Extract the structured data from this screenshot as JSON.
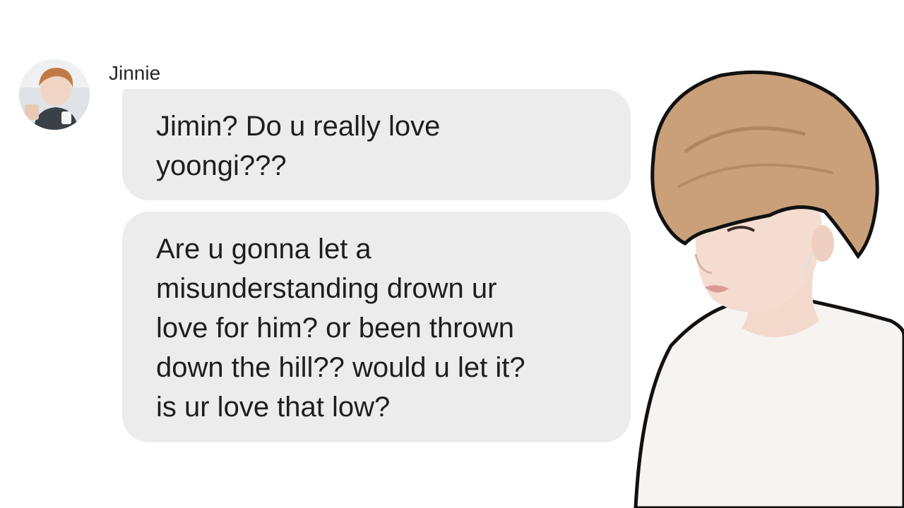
{
  "chat": {
    "sender_name": "Jinnie",
    "messages": [
      {
        "text": "Jimin? Do u really love\nyoongi???"
      },
      {
        "text": "Are u gonna let a\nmisunderstanding drown ur\nlove for him? or been thrown\ndown the hill?? would u let it?\nis ur love that low?"
      }
    ]
  },
  "colors": {
    "background": "#ffffff",
    "bubble": "#ececec",
    "text": "#1e1e1e",
    "hair": "#c9a07a",
    "skin": "#f4ddd0",
    "shirt": "#f6f3f1"
  }
}
